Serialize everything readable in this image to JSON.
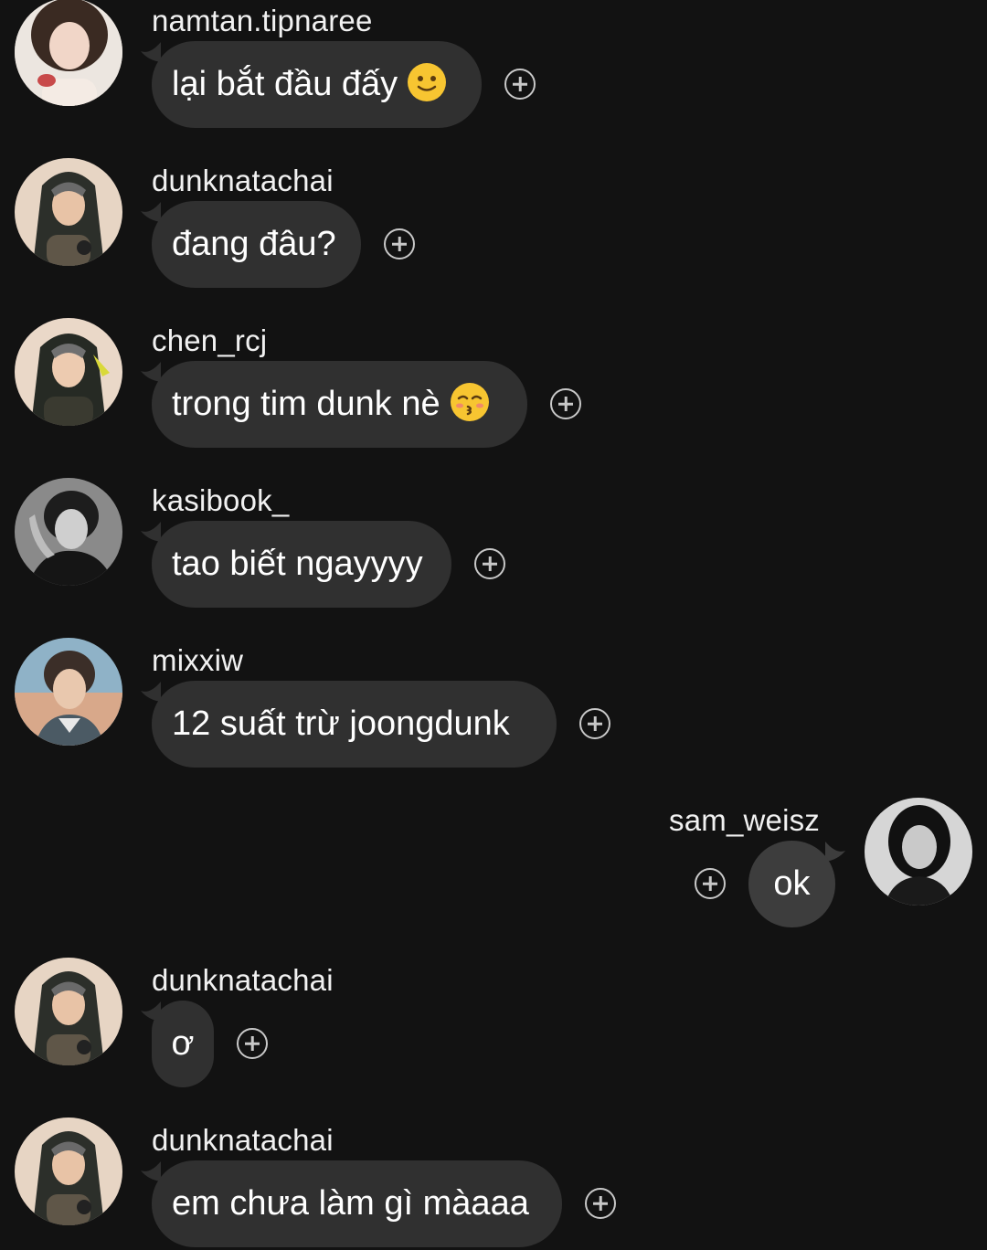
{
  "messages": [
    {
      "username": "namtan.tipnaree",
      "text": "lại bắt đầu đấy",
      "emoji_icon": "slightly-smiling-face-icon"
    },
    {
      "username": "dunknatachai",
      "text": "đang đâu?"
    },
    {
      "username": "chen_rcj",
      "text": "trong tim dunk nè",
      "emoji_icon": "kissing-face-closed-eyes-icon"
    },
    {
      "username": "kasibook_",
      "text": "tao biết ngayyyy"
    },
    {
      "username": "mixxiw",
      "text": "12 suất trừ joongdunk"
    },
    {
      "username": "sam_weisz",
      "text": "ok",
      "own": true
    },
    {
      "username": "dunknatachai",
      "text": "ơ"
    },
    {
      "username": "dunknatachai",
      "text": "em chưa làm gì màaaa"
    }
  ],
  "colors": {
    "background": "#121212",
    "bubble": "#303030",
    "own_bubble": "#3d3d3d",
    "text": "#ffffff",
    "react_icon": "#c8c8c8"
  }
}
